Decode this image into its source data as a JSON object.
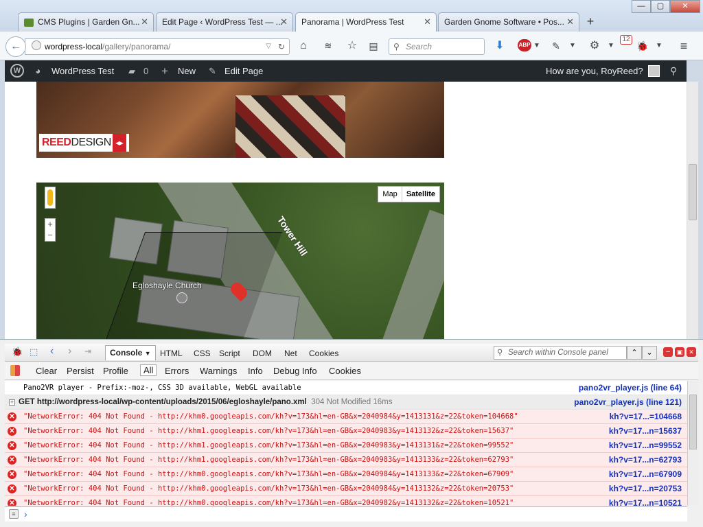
{
  "tabs": [
    {
      "label": "CMS Plugins | Garden Gn...",
      "active": false
    },
    {
      "label": "Edit Page ‹ WordPress Test — ...",
      "active": false
    },
    {
      "label": "Panorama | WordPress Test",
      "active": true
    },
    {
      "label": "Garden Gnome Software • Pos...",
      "active": false
    }
  ],
  "window": {
    "minimize": "—",
    "maximize": "▢",
    "close": "✕"
  },
  "nav": {
    "url_host": "wordpress-local",
    "url_path": "/gallery/panorama/",
    "search_placeholder": "Search",
    "badge_count": "12"
  },
  "wpbar": {
    "site": "WordPress Test",
    "comments": "0",
    "new": "New",
    "edit": "Edit Page",
    "greeting": "How are you, RoyReed?"
  },
  "content": {
    "logo_reed": "REED",
    "logo_design": "DESIGN",
    "map_btn": "Map",
    "satellite_btn": "Satellite",
    "church_label": "Egloshayle Church",
    "road_label": "Tower Hill"
  },
  "firebug": {
    "tabs": [
      "Console",
      "HTML",
      "CSS",
      "Script",
      "DOM",
      "Net",
      "Cookies"
    ],
    "search_placeholder": "Search within Console panel",
    "filters": [
      "Clear",
      "Persist",
      "Profile",
      "All",
      "Errors",
      "Warnings",
      "Info",
      "Debug Info",
      "Cookies"
    ],
    "log": [
      {
        "type": "info",
        "msg": "Pano2VR player - Prefix:-moz-, CSS 3D available, WebGL available",
        "src": "pano2vr_player.js (line 64)"
      },
      {
        "type": "get",
        "msg": "GET http://wordpress-local/wp-content/uploads/2015/06/egloshayle/pano.xml",
        "status": "304 Not Modified 16ms",
        "src": "pano2vr_player.js (line 121)"
      },
      {
        "type": "err",
        "msg": "\"NetworkError: 404 Not Found - http://khm0.googleapis.com/kh?v=173&hl=en-GB&x=2040984&y=1413131&z=22&token=104668\"",
        "src": "kh?v=17...=104668"
      },
      {
        "type": "err",
        "msg": "\"NetworkError: 404 Not Found - http://khm1.googleapis.com/kh?v=173&hl=en-GB&x=2040983&y=1413132&z=22&token=15637\"",
        "src": "kh?v=17...n=15637"
      },
      {
        "type": "err",
        "msg": "\"NetworkError: 404 Not Found - http://khm1.googleapis.com/kh?v=173&hl=en-GB&x=2040983&y=1413131&z=22&token=99552\"",
        "src": "kh?v=17...n=99552"
      },
      {
        "type": "err",
        "msg": "\"NetworkError: 404 Not Found - http://khm1.googleapis.com/kh?v=173&hl=en-GB&x=2040983&y=1413133&z=22&token=62793\"",
        "src": "kh?v=17...n=62793"
      },
      {
        "type": "err",
        "msg": "\"NetworkError: 404 Not Found - http://khm0.googleapis.com/kh?v=173&hl=en-GB&x=2040984&y=1413133&z=22&token=67909\"",
        "src": "kh?v=17...n=67909"
      },
      {
        "type": "err",
        "msg": "\"NetworkError: 404 Not Found - http://khm0.googleapis.com/kh?v=173&hl=en-GB&x=2040984&y=1413132&z=22&token=20753\"",
        "src": "kh?v=17...n=20753"
      },
      {
        "type": "err",
        "msg": "\"NetworkError: 404 Not Found - http://khm0.googleapis.com/kh?v=173&hl=en-GB&x=2040982&y=1413132&z=22&token=10521\"",
        "src": "kh?v=17...n=10521"
      }
    ],
    "prompt": "›"
  }
}
